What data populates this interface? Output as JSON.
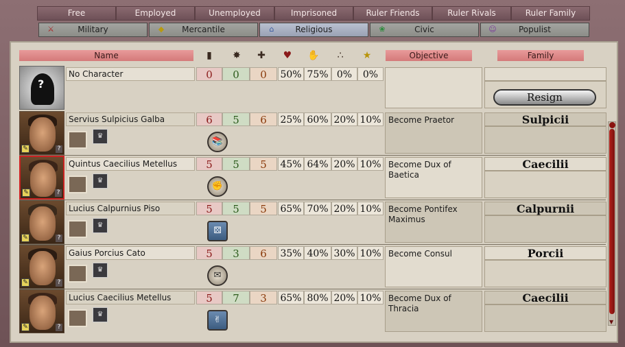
{
  "filter_tabs": [
    "Free",
    "Employed",
    "Unemployed",
    "Imprisoned",
    "Ruler Friends",
    "Ruler Rivals",
    "Ruler Family"
  ],
  "faction_tabs": [
    {
      "label": "Military",
      "icon": "sword-icon",
      "active": false
    },
    {
      "label": "Mercantile",
      "icon": "trade-icon",
      "active": false
    },
    {
      "label": "Religious",
      "icon": "temple-icon",
      "active": true
    },
    {
      "label": "Civic",
      "icon": "civic-icon",
      "active": false
    },
    {
      "label": "Populist",
      "icon": "populist-icon",
      "active": false
    }
  ],
  "headers": {
    "name": "Name",
    "objective": "Objective",
    "family": "Family"
  },
  "header_icons": [
    "martial-icon",
    "finesse-icon",
    "zeal-icon",
    "loyalty-icon",
    "popularity-icon",
    "corruption-icon",
    "prominence-icon"
  ],
  "no_character": {
    "name": "No Character",
    "stats": [
      "0",
      "0",
      "0"
    ],
    "pcts": [
      "50%",
      "75%",
      "0%",
      "0%"
    ],
    "resign_label": "Resign"
  },
  "characters": [
    {
      "name": "Servius Sulpicius Galba",
      "stats": [
        "6",
        "5",
        "6"
      ],
      "pcts": [
        "25%",
        "60%",
        "20%",
        "10%"
      ],
      "objective": "Become Praetor",
      "family": "Sulpicii",
      "trait_icon": "book-icon"
    },
    {
      "name": "Quintus Caecilius Metellus",
      "stats": [
        "5",
        "5",
        "5"
      ],
      "pcts": [
        "45%",
        "64%",
        "20%",
        "10%"
      ],
      "objective": "Become Dux of Baetica",
      "family": "Caecilii",
      "trait_icon": "fist-icon"
    },
    {
      "name": "Lucius Calpurnius Piso",
      "stats": [
        "5",
        "5",
        "5"
      ],
      "pcts": [
        "65%",
        "70%",
        "20%",
        "10%"
      ],
      "objective": "Become Pontifex Maximus",
      "family": "Calpurnii",
      "trait_icon": "dice-icon"
    },
    {
      "name": "Gaius Porcius Cato",
      "stats": [
        "5",
        "3",
        "6"
      ],
      "pcts": [
        "35%",
        "40%",
        "30%",
        "10%"
      ],
      "objective": "Become Consul",
      "family": "Porcii",
      "trait_icon": "speech-icon"
    },
    {
      "name": "Lucius Caecilius Metellus",
      "stats": [
        "5",
        "7",
        "3"
      ],
      "pcts": [
        "65%",
        "80%",
        "20%",
        "10%"
      ],
      "objective": "Become Dux of Thracia",
      "family": "Caecilii",
      "trait_icon": "thumbs-up-icon"
    }
  ]
}
